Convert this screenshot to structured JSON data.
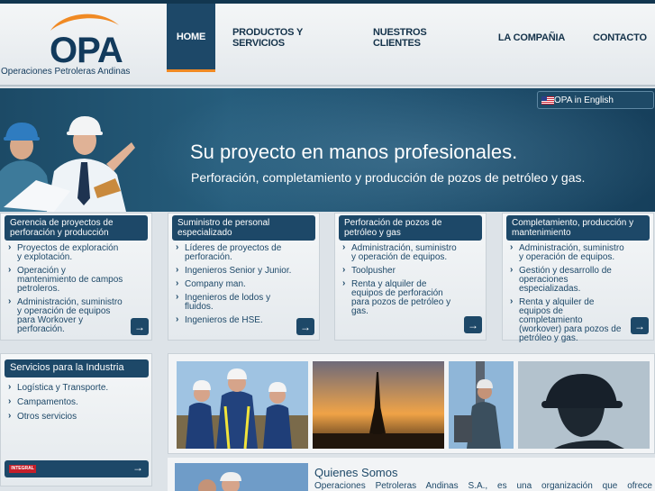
{
  "logo": {
    "name": "OPA",
    "subtitle": "Operaciones Petroleras Andinas"
  },
  "nav": [
    {
      "label": "HOME"
    },
    {
      "label": "PRODUCTOS Y SERVICIOS"
    },
    {
      "label": "NUESTROS CLIENTES"
    },
    {
      "label": "LA COMPAÑIA"
    },
    {
      "label": "CONTACTO"
    }
  ],
  "lang_button": "OPA in English",
  "hero": {
    "title": "Su proyecto en manos profesionales.",
    "subtitle": "Perforación, completamiento y producción de pozos de petróleo y gas."
  },
  "cards": [
    {
      "title": "Gerencia de proyectos de perforación y producción",
      "items": [
        "Proyectos de exploración y explotación.",
        "Operación y mantenimiento de campos petroleros.",
        "Administración, suministro y operación de equipos para Workover y perforación."
      ]
    },
    {
      "title": "Suministro de personal especializado",
      "items": [
        "Líderes de proyectos de perforación.",
        "Ingenieros Senior y Junior.",
        "Company man.",
        "Ingenieros de lodos y fluidos.",
        "Ingenieros de HSE."
      ]
    },
    {
      "title": "Perforación de pozos de petróleo y gas",
      "items": [
        "Administración, suministro y operación de equipos.",
        "Toolpusher",
        "Renta y alquiler de equipos de perforación para pozos de petróleo y gas."
      ]
    },
    {
      "title": "Completamiento, producción y mantenimiento",
      "items": [
        "Administración, suministro y operación de equipos.",
        "Gestión y desarrollo de operaciones especializadas.",
        "Renta y alquiler de equipos de completamiento (workover) para pozos de petróleo y gas."
      ]
    }
  ],
  "services": {
    "title": "Servicios para la Industria",
    "items": [
      "Logística y Transporte.",
      "Campamentos.",
      "Otros servicios"
    ],
    "integral_label": "INTEGRAL"
  },
  "quienes": {
    "title": "Quienes Somos",
    "text": "Operaciones Petroleras Andinas S.A., es una organización que ofrece"
  },
  "colors": {
    "navy": "#1d4868",
    "accent": "#f08a24"
  }
}
